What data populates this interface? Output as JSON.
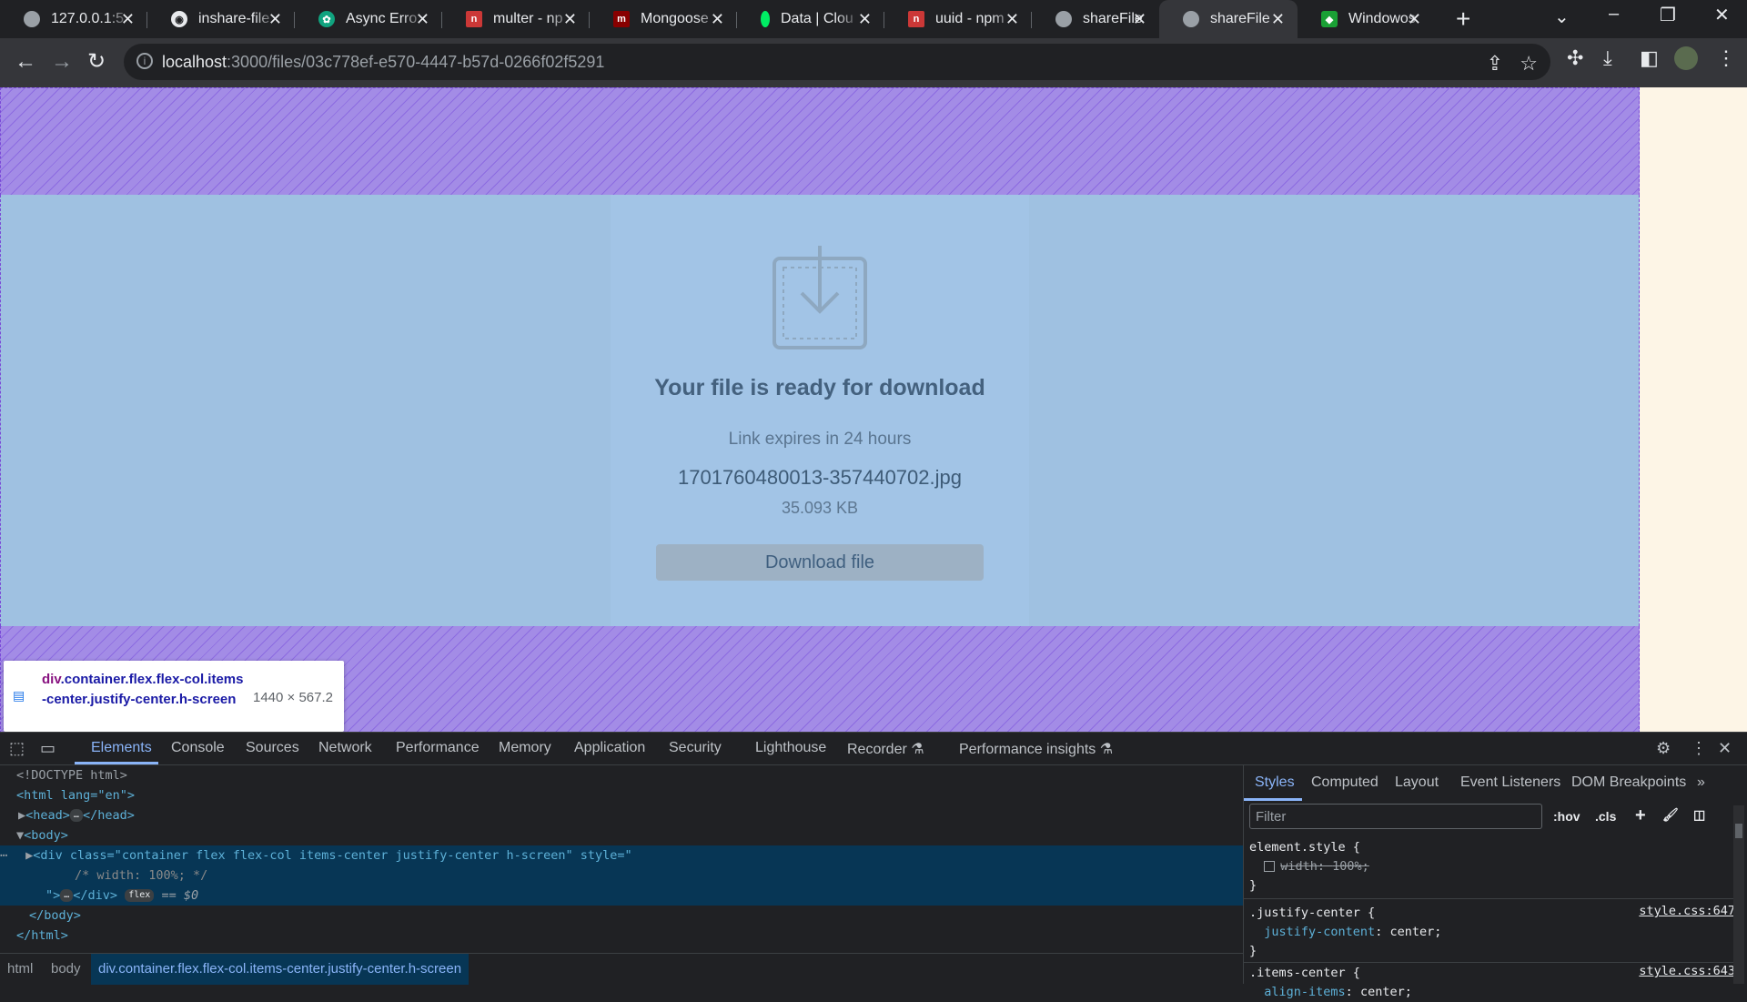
{
  "tabs": [
    {
      "title": "127.0.0.1:5",
      "icon": "globe-icon"
    },
    {
      "title": "inshare-file",
      "icon": "github-icon"
    },
    {
      "title": "Async Erro",
      "icon": "openai-icon"
    },
    {
      "title": "multer - np",
      "icon": "npm-icon"
    },
    {
      "title": "Mongoose",
      "icon": "mongoose-icon"
    },
    {
      "title": "Data | Clou",
      "icon": "mongodb-leaf-icon"
    },
    {
      "title": "uuid - npm",
      "icon": "npm-icon"
    },
    {
      "title": "shareFile",
      "icon": "globe-icon"
    },
    {
      "title": "shareFile",
      "icon": "globe-icon",
      "active": true
    },
    {
      "title": "Windowos",
      "icon": "green-app-icon"
    }
  ],
  "address": {
    "host": "localhost",
    "path": ":3000/files/03c778ef-e570-4447-b57d-0266f02f5291"
  },
  "page": {
    "heading": "Your file is ready for download",
    "expires": "Link expires in 24 hours",
    "filename": "1701760480013-357440702.jpg",
    "filesize": "35.093 KB",
    "download_label": "Download file"
  },
  "inspector_tooltip": {
    "tag": "div",
    "classes": ".container.flex.flex-col.items-center.justify-center.h-screen",
    "dimensions": "1440 × 567.2"
  },
  "devtools": {
    "tabs": [
      "Elements",
      "Console",
      "Sources",
      "Network",
      "Performance",
      "Memory",
      "Application",
      "Security",
      "Lighthouse",
      "Recorder",
      "Performance insights"
    ],
    "active_tab": "Elements",
    "dom": {
      "doctype": "<!DOCTYPE html>",
      "html_open": "<html lang=\"en\">",
      "head": "<head>",
      "head_close": "</head>",
      "body_open": "<body>",
      "div_open": "<div class=\"container flex flex-col items-center justify-center h-screen\" style=\"",
      "div_comment": "/* width: 100%; */",
      "div_close": "</div>",
      "flex_badge": "flex",
      "dollar0": "== $0",
      "body_close": "</body>",
      "html_close": "</html>"
    },
    "breadcrumbs": [
      "html",
      "body",
      "div.container.flex.flex-col.items-center.justify-center.h-screen"
    ],
    "styles_tabs": [
      "Styles",
      "Computed",
      "Layout",
      "Event Listeners",
      "DOM Breakpoints"
    ],
    "filter_placeholder": "Filter",
    "hov": ":hov",
    "cls": ".cls",
    "rules": {
      "element_style_selector": "element.style {",
      "element_style_prop": "width",
      "element_style_value": "100%;",
      "close": "}",
      "jc_selector": ".justify-center {",
      "jc_prop": "justify-content",
      "jc_value": "center;",
      "jc_source": "style.css:647",
      "ic_selector": ".items-center {",
      "ic_prop": "align-items",
      "ic_value": "center;",
      "ic_source": "style.css:643"
    }
  }
}
